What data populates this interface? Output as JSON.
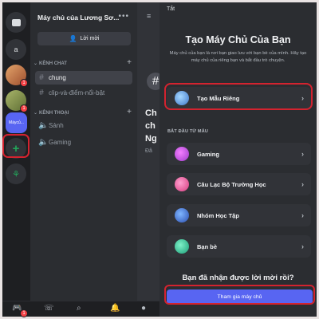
{
  "rail": {
    "items": [
      {
        "name": "direct-messages-icon",
        "glyph": "▣",
        "bg": "#313338"
      },
      {
        "name": "server-a",
        "label": "a",
        "bg": "#313338"
      },
      {
        "name": "server-avatar-1",
        "glyph": "",
        "bg": "#c26b44",
        "badge": "1"
      },
      {
        "name": "server-avatar-2",
        "glyph": "",
        "bg": "#7a8c4a",
        "badge": "1"
      },
      {
        "name": "server-current",
        "label": "Máycủ...",
        "bg": "#5865f2"
      }
    ],
    "add_server_icon": "+",
    "discover_icon": "⚘"
  },
  "channels": {
    "server_title": "Máy chủ của Lương Sơ...",
    "more_icon": "•••",
    "invite_label": "Lời mời",
    "text_category": "KÊNH CHAT",
    "text_channels": [
      "chung",
      "clip-và-điểm-nổi-bật"
    ],
    "voice_category": "KÊNH THOẠI",
    "voice_channels": [
      "Sảnh",
      "Gaming"
    ]
  },
  "peek": {
    "lines": [
      "Ch",
      "ch",
      "Ng",
      "Đâ"
    ]
  },
  "modal": {
    "close_label": "Tắt",
    "title": "Tạo Máy Chủ Của Bạn",
    "description": "Máy chủ của bạn là nơi bạn giao lưu với bạn bè của mình. Hãy tạo máy chủ của riêng bạn và bắt đầu trò chuyện.",
    "create_own": "Tạo Mẫu Riêng",
    "template_section": "BẮT ĐẦU TỪ MẪU",
    "templates": [
      "Gaming",
      "Câu Lạc Bộ Trường Học",
      "Nhóm Học Tập",
      "Bạn bè"
    ],
    "invite_prompt": "Bạn đã nhận được lời mời rồi?",
    "join_button": "Tham gia máy chủ"
  },
  "colors": {
    "accent": "#5865f2",
    "highlight": "#d3232f",
    "add_green": "#23a55a"
  }
}
